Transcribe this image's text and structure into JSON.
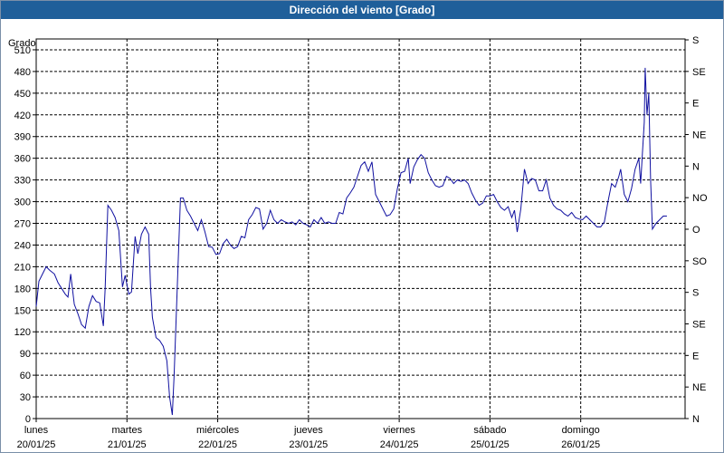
{
  "window": {
    "title": "Dirección del viento [Grado]"
  },
  "chart_data": {
    "type": "line",
    "title": "Dirección del viento [Grado]",
    "ylabel": "Grado",
    "ylim": [
      0,
      525
    ],
    "yticks": [
      0,
      30,
      60,
      90,
      120,
      150,
      180,
      210,
      240,
      270,
      300,
      330,
      360,
      390,
      420,
      450,
      480,
      510
    ],
    "xlim": [
      0,
      7.15
    ],
    "right_axis": {
      "labels": [
        "N",
        "NE",
        "E",
        "SE",
        "S",
        "SO",
        "O",
        "NO",
        "N",
        "NE",
        "E",
        "SE",
        "S"
      ],
      "values": [
        0,
        45,
        90,
        135,
        180,
        225,
        270,
        315,
        360,
        405,
        450,
        495,
        540
      ]
    },
    "x_ticks": [
      {
        "day": "lunes",
        "date": "20/01/25",
        "x": 0
      },
      {
        "day": "martes",
        "date": "21/01/25",
        "x": 1
      },
      {
        "day": "miércoles",
        "date": "22/01/25",
        "x": 2
      },
      {
        "day": "jueves",
        "date": "23/01/25",
        "x": 3
      },
      {
        "day": "viernes",
        "date": "24/01/25",
        "x": 4
      },
      {
        "day": "sábado",
        "date": "25/01/25",
        "x": 5
      },
      {
        "day": "domingo",
        "date": "26/01/25",
        "x": 6
      }
    ],
    "grid": true,
    "line_color": "#1010a0",
    "series": [
      {
        "values": [
          [
            0.0,
            155
          ],
          [
            0.03,
            190
          ],
          [
            0.07,
            200
          ],
          [
            0.11,
            210
          ],
          [
            0.15,
            205
          ],
          [
            0.2,
            200
          ],
          [
            0.24,
            188
          ],
          [
            0.28,
            180
          ],
          [
            0.32,
            172
          ],
          [
            0.35,
            168
          ],
          [
            0.38,
            200
          ],
          [
            0.42,
            158
          ],
          [
            0.46,
            145
          ],
          [
            0.5,
            130
          ],
          [
            0.54,
            125
          ],
          [
            0.58,
            155
          ],
          [
            0.62,
            170
          ],
          [
            0.66,
            162
          ],
          [
            0.7,
            160
          ],
          [
            0.74,
            128
          ],
          [
            0.76,
            180
          ],
          [
            0.79,
            295
          ],
          [
            0.83,
            288
          ],
          [
            0.87,
            278
          ],
          [
            0.91,
            260
          ],
          [
            0.95,
            182
          ],
          [
            0.98,
            198
          ],
          [
            1.02,
            172
          ],
          [
            1.05,
            175
          ],
          [
            1.09,
            252
          ],
          [
            1.12,
            228
          ],
          [
            1.16,
            255
          ],
          [
            1.2,
            265
          ],
          [
            1.24,
            255
          ],
          [
            1.26,
            180
          ],
          [
            1.28,
            140
          ],
          [
            1.32,
            112
          ],
          [
            1.36,
            108
          ],
          [
            1.4,
            100
          ],
          [
            1.44,
            80
          ],
          [
            1.47,
            30
          ],
          [
            1.5,
            5
          ],
          [
            1.52,
            60
          ],
          [
            1.56,
            200
          ],
          [
            1.59,
            305
          ],
          [
            1.62,
            305
          ],
          [
            1.66,
            288
          ],
          [
            1.7,
            280
          ],
          [
            1.74,
            270
          ],
          [
            1.78,
            260
          ],
          [
            1.82,
            275
          ],
          [
            1.86,
            258
          ],
          [
            1.9,
            238
          ],
          [
            1.94,
            237
          ],
          [
            1.98,
            227
          ],
          [
            2.02,
            228
          ],
          [
            2.06,
            242
          ],
          [
            2.1,
            248
          ],
          [
            2.14,
            240
          ],
          [
            2.18,
            235
          ],
          [
            2.22,
            238
          ],
          [
            2.26,
            252
          ],
          [
            2.3,
            250
          ],
          [
            2.34,
            275
          ],
          [
            2.38,
            282
          ],
          [
            2.42,
            292
          ],
          [
            2.46,
            290
          ],
          [
            2.5,
            262
          ],
          [
            2.54,
            270
          ],
          [
            2.58,
            288
          ],
          [
            2.62,
            275
          ],
          [
            2.66,
            270
          ],
          [
            2.7,
            275
          ],
          [
            2.74,
            272
          ],
          [
            2.78,
            270
          ],
          [
            2.82,
            272
          ],
          [
            2.86,
            268
          ],
          [
            2.9,
            275
          ],
          [
            2.94,
            270
          ],
          [
            2.98,
            268
          ],
          [
            3.02,
            265
          ],
          [
            3.06,
            275
          ],
          [
            3.1,
            270
          ],
          [
            3.14,
            278
          ],
          [
            3.18,
            270
          ],
          [
            3.22,
            272
          ],
          [
            3.26,
            270
          ],
          [
            3.3,
            270
          ],
          [
            3.34,
            285
          ],
          [
            3.38,
            283
          ],
          [
            3.42,
            305
          ],
          [
            3.46,
            312
          ],
          [
            3.5,
            320
          ],
          [
            3.54,
            335
          ],
          [
            3.58,
            350
          ],
          [
            3.62,
            355
          ],
          [
            3.66,
            342
          ],
          [
            3.7,
            355
          ],
          [
            3.74,
            310
          ],
          [
            3.78,
            300
          ],
          [
            3.82,
            290
          ],
          [
            3.86,
            280
          ],
          [
            3.9,
            282
          ],
          [
            3.94,
            290
          ],
          [
            3.98,
            318
          ],
          [
            4.02,
            340
          ],
          [
            4.06,
            342
          ],
          [
            4.1,
            360
          ],
          [
            4.12,
            325
          ],
          [
            4.16,
            348
          ],
          [
            4.2,
            358
          ],
          [
            4.24,
            365
          ],
          [
            4.28,
            360
          ],
          [
            4.32,
            340
          ],
          [
            4.36,
            330
          ],
          [
            4.4,
            322
          ],
          [
            4.44,
            320
          ],
          [
            4.48,
            322
          ],
          [
            4.52,
            335
          ],
          [
            4.56,
            332
          ],
          [
            4.6,
            325
          ],
          [
            4.64,
            330
          ],
          [
            4.68,
            328
          ],
          [
            4.72,
            330
          ],
          [
            4.76,
            325
          ],
          [
            4.8,
            312
          ],
          [
            4.84,
            302
          ],
          [
            4.88,
            295
          ],
          [
            4.92,
            298
          ],
          [
            4.96,
            308
          ],
          [
            5.0,
            308
          ],
          [
            5.04,
            310
          ],
          [
            5.08,
            300
          ],
          [
            5.12,
            292
          ],
          [
            5.16,
            288
          ],
          [
            5.2,
            293
          ],
          [
            5.24,
            278
          ],
          [
            5.27,
            288
          ],
          [
            5.3,
            258
          ],
          [
            5.34,
            290
          ],
          [
            5.38,
            345
          ],
          [
            5.42,
            325
          ],
          [
            5.46,
            332
          ],
          [
            5.5,
            330
          ],
          [
            5.54,
            315
          ],
          [
            5.58,
            315
          ],
          [
            5.62,
            330
          ],
          [
            5.66,
            305
          ],
          [
            5.7,
            295
          ],
          [
            5.74,
            290
          ],
          [
            5.78,
            288
          ],
          [
            5.82,
            283
          ],
          [
            5.86,
            280
          ],
          [
            5.9,
            285
          ],
          [
            5.94,
            278
          ],
          [
            5.98,
            276
          ],
          [
            6.02,
            275
          ],
          [
            6.06,
            280
          ],
          [
            6.1,
            275
          ],
          [
            6.14,
            270
          ],
          [
            6.18,
            265
          ],
          [
            6.22,
            265
          ],
          [
            6.26,
            272
          ],
          [
            6.3,
            300
          ],
          [
            6.34,
            325
          ],
          [
            6.38,
            320
          ],
          [
            6.42,
            335
          ],
          [
            6.44,
            345
          ],
          [
            6.48,
            310
          ],
          [
            6.52,
            300
          ],
          [
            6.56,
            318
          ],
          [
            6.6,
            345
          ],
          [
            6.64,
            360
          ],
          [
            6.66,
            325
          ],
          [
            6.68,
            368
          ],
          [
            6.7,
            410
          ],
          [
            6.71,
            485
          ],
          [
            6.73,
            420
          ],
          [
            6.75,
            450
          ],
          [
            6.77,
            330
          ],
          [
            6.79,
            262
          ],
          [
            6.83,
            270
          ],
          [
            6.87,
            275
          ],
          [
            6.91,
            280
          ],
          [
            6.95,
            280
          ]
        ]
      }
    ]
  }
}
